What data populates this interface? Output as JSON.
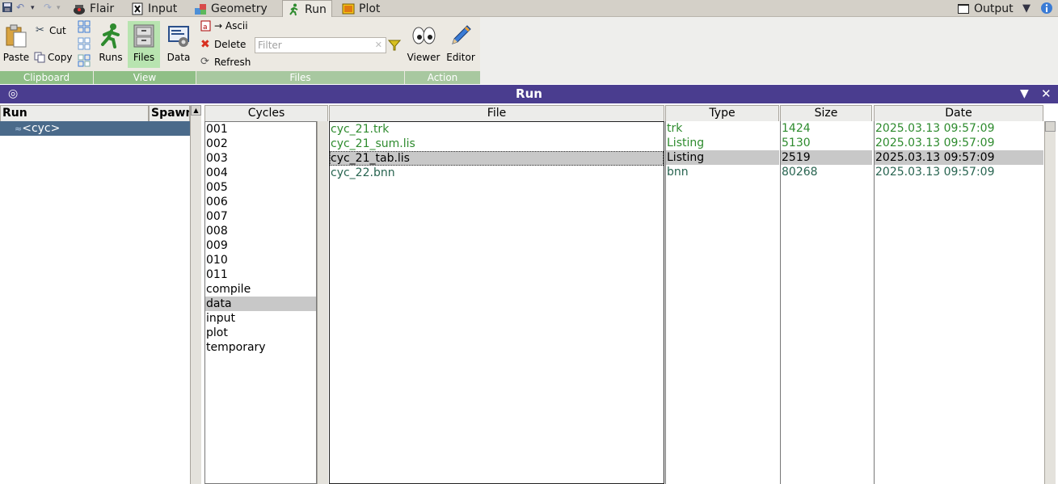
{
  "tabs": [
    {
      "label": "Flair",
      "icon": "flair-icon"
    },
    {
      "label": "Input",
      "icon": "input-icon"
    },
    {
      "label": "Geometry",
      "icon": "geometry-icon"
    },
    {
      "label": "Run",
      "icon": "run-icon",
      "active": true
    },
    {
      "label": "Plot",
      "icon": "plot-icon"
    }
  ],
  "output_label": "Output",
  "ribbon": {
    "clipboard": {
      "paste": "Paste",
      "cut": "Cut",
      "copy": "Copy",
      "label": "Clipboard"
    },
    "view": {
      "runs": "Runs",
      "files": "Files",
      "data": "Data",
      "label": "View"
    },
    "files": {
      "ascii": "→ Ascii",
      "delete": "Delete",
      "refresh": "Refresh",
      "filter_placeholder": "Filter",
      "label": "Files"
    },
    "action": {
      "viewer": "Viewer",
      "editor": "Editor",
      "label": "Action"
    },
    "group_color": "#a8c8a0"
  },
  "panel_title": "Run",
  "run_tree": {
    "col_run": "Run",
    "col_spawn": "Spawn",
    "item": "<cyc>"
  },
  "cycles": {
    "header": "Cycles",
    "items": [
      "001",
      "002",
      "003",
      "004",
      "005",
      "006",
      "007",
      "008",
      "009",
      "010",
      "011",
      "compile",
      "data",
      "input",
      "plot",
      "temporary"
    ],
    "selected": "data"
  },
  "files_table": {
    "headers": {
      "file": "File",
      "type": "Type",
      "size": "Size",
      "date": "Date"
    },
    "rows": [
      {
        "file": "cyc_21.trk",
        "type": "trk",
        "size": "1424",
        "date": "2025.03.13 09:57:09",
        "color": "green"
      },
      {
        "file": "cyc_21_sum.lis",
        "type": "Listing",
        "size": "5130",
        "date": "2025.03.13 09:57:09",
        "color": "green"
      },
      {
        "file": "cyc_21_tab.lis",
        "type": "Listing",
        "size": "2519",
        "date": "2025.03.13 09:57:09",
        "color": "black",
        "selected": true
      },
      {
        "file": "cyc_22.bnn",
        "type": "bnn",
        "size": "80268",
        "date": "2025.03.13 09:57:09",
        "color": "teal"
      }
    ]
  }
}
